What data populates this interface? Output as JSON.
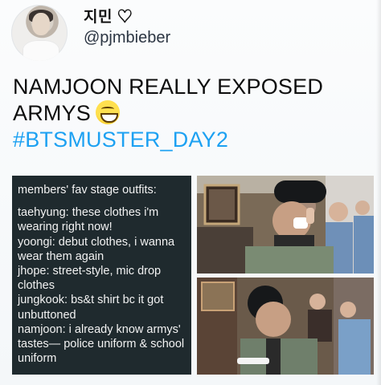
{
  "author": {
    "display_name": "지민 ♡",
    "handle": "@pjmbieber"
  },
  "tweet": {
    "line1": "NAMJOON REALLY EXPOSED",
    "line2": "ARMYS",
    "hashtag": "#BTSMUSTER_DAY2"
  },
  "colors": {
    "hashtag": "#1da1f2",
    "panel_bg": "#1f2a2e"
  },
  "screenshot": {
    "lines": [
      "members' fav stage outfits:",
      "",
      "taehyung: these clothes i'm",
      "wearing right now!",
      "yoongi: debut clothes, i wanna",
      "wear them again",
      "jhope: street-style, mic drop",
      "clothes",
      "jungkook: bs&t shirt bc it got",
      "unbuttoned",
      "namjoon: i already know armys'",
      "tastes— police uniform & school",
      "uniform"
    ]
  },
  "icons": {
    "avatar": "profile-photo",
    "emoji": "grinning-squinting-face-emoji"
  }
}
